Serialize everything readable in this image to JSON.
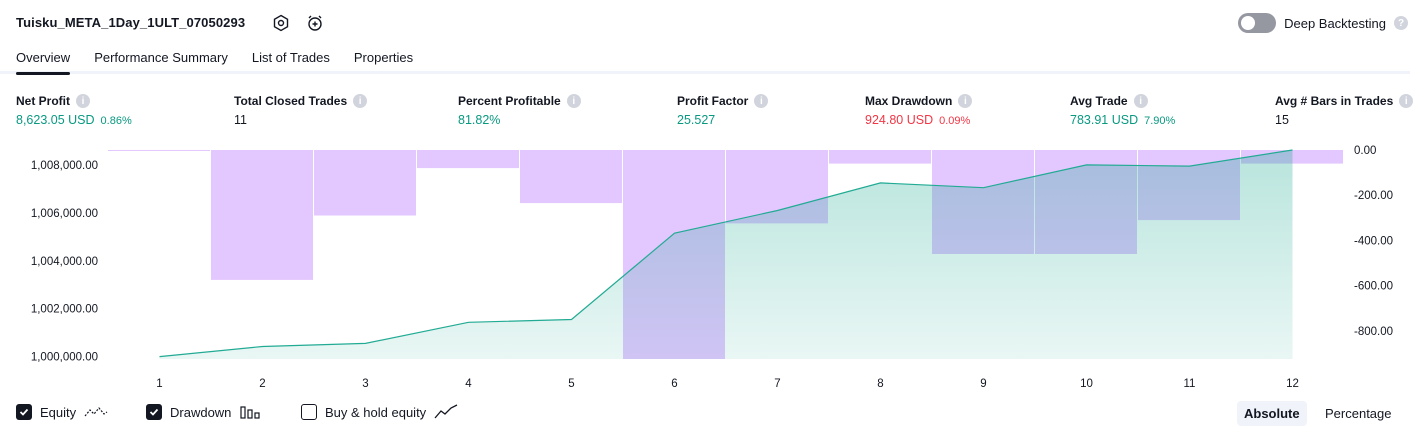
{
  "header": {
    "title": "Tuisku_META_1Day_1ULT_07050293",
    "deep_backtesting_label": "Deep Backtesting",
    "deep_backtesting_enabled": false
  },
  "tabs": [
    {
      "label": "Overview",
      "active": true
    },
    {
      "label": "Performance Summary",
      "active": false
    },
    {
      "label": "List of Trades",
      "active": false
    },
    {
      "label": "Properties",
      "active": false
    }
  ],
  "metrics": {
    "net_profit": {
      "label": "Net Profit",
      "value": "8,623.05 USD",
      "pct": "0.86%"
    },
    "total_closed_trades": {
      "label": "Total Closed Trades",
      "value": "11"
    },
    "percent_profitable": {
      "label": "Percent Profitable",
      "value": "81.82%"
    },
    "profit_factor": {
      "label": "Profit Factor",
      "value": "25.527"
    },
    "max_drawdown": {
      "label": "Max Drawdown",
      "value": "924.80 USD",
      "pct": "0.09%"
    },
    "avg_trade": {
      "label": "Avg Trade",
      "value": "783.91 USD",
      "pct": "7.90%"
    },
    "avg_bars": {
      "label": "Avg # Bars in Trades",
      "value": "15"
    }
  },
  "chart_data": {
    "type": "line",
    "x": [
      1,
      2,
      3,
      4,
      5,
      6,
      7,
      8,
      9,
      10,
      11,
      12
    ],
    "series": [
      {
        "name": "Equity",
        "axis": "left",
        "values": [
          1000000,
          1000420,
          1000550,
          1001430,
          1001550,
          1005150,
          1006100,
          1007250,
          1007050,
          1008000,
          1007950,
          1008623.05
        ]
      },
      {
        "name": "Drawdown",
        "axis": "right",
        "style": "bars",
        "values": [
          0,
          -575,
          -290,
          -80,
          -235,
          -925,
          -325,
          -60,
          -460,
          -460,
          -310,
          -60
        ]
      }
    ],
    "left_axis": {
      "ticks": [
        "1,000,000.00",
        "1,002,000.00",
        "1,004,000.00",
        "1,006,000.00",
        "1,008,000.00"
      ],
      "range": [
        999900,
        1008623.05
      ]
    },
    "right_axis": {
      "ticks": [
        "0.00",
        "-200.00",
        "-400.00",
        "-600.00",
        "-800.00"
      ],
      "range": [
        0,
        -924.8
      ]
    },
    "colors": {
      "equity_line": "#22ab94",
      "equity_fill": "#22ab94",
      "drawdown_bar": "#e1c4ff"
    }
  },
  "legend": {
    "equity": {
      "label": "Equity",
      "checked": true
    },
    "drawdown": {
      "label": "Drawdown",
      "checked": true
    },
    "buy_hold": {
      "label": "Buy & hold equity",
      "checked": false
    }
  },
  "modes": {
    "absolute": "Absolute",
    "percentage": "Percentage",
    "active": "absolute"
  }
}
